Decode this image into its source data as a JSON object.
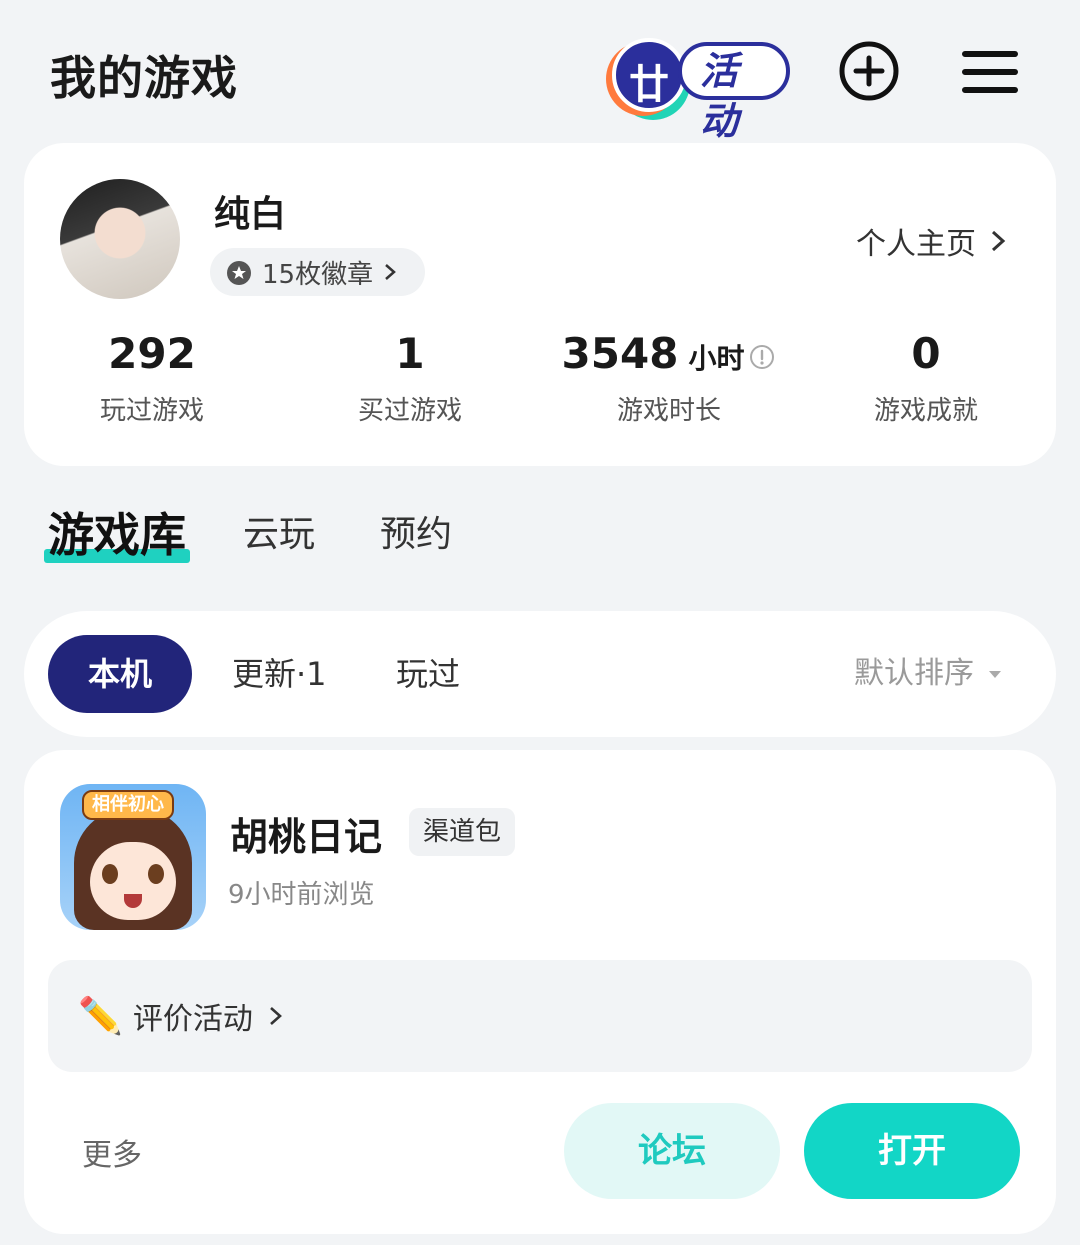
{
  "header": {
    "title": "我的游戏",
    "activity_label": "活动",
    "activity_glyph": "廿"
  },
  "profile": {
    "username": "纯白",
    "badges_label": "15枚徽章",
    "homepage_label": "个人主页",
    "stats": [
      {
        "value": "292",
        "label": "玩过游戏"
      },
      {
        "value": "1",
        "label": "买过游戏"
      },
      {
        "value": "3548",
        "unit": "小时",
        "label": "游戏时长"
      },
      {
        "value": "0",
        "label": "游戏成就"
      }
    ]
  },
  "main_tabs": [
    {
      "label": "游戏库",
      "active": true
    },
    {
      "label": "云玩",
      "active": false
    },
    {
      "label": "预约",
      "active": false
    }
  ],
  "filters": {
    "chips": [
      {
        "label": "本机",
        "active": true
      },
      {
        "label": "更新·1",
        "active": false
      },
      {
        "label": "玩过",
        "active": false
      }
    ],
    "sort_label": "默认排序"
  },
  "game": {
    "title": "胡桃日记",
    "tag": "渠道包",
    "last_seen": "9小时前浏览",
    "icon_banner": "相伴初心",
    "review_label": "评价活动",
    "more_label": "更多",
    "forum_label": "论坛",
    "open_label": "打开"
  },
  "colors": {
    "accent_teal": "#12d6c6",
    "navy": "#22257a",
    "background": "#f2f4f6"
  }
}
